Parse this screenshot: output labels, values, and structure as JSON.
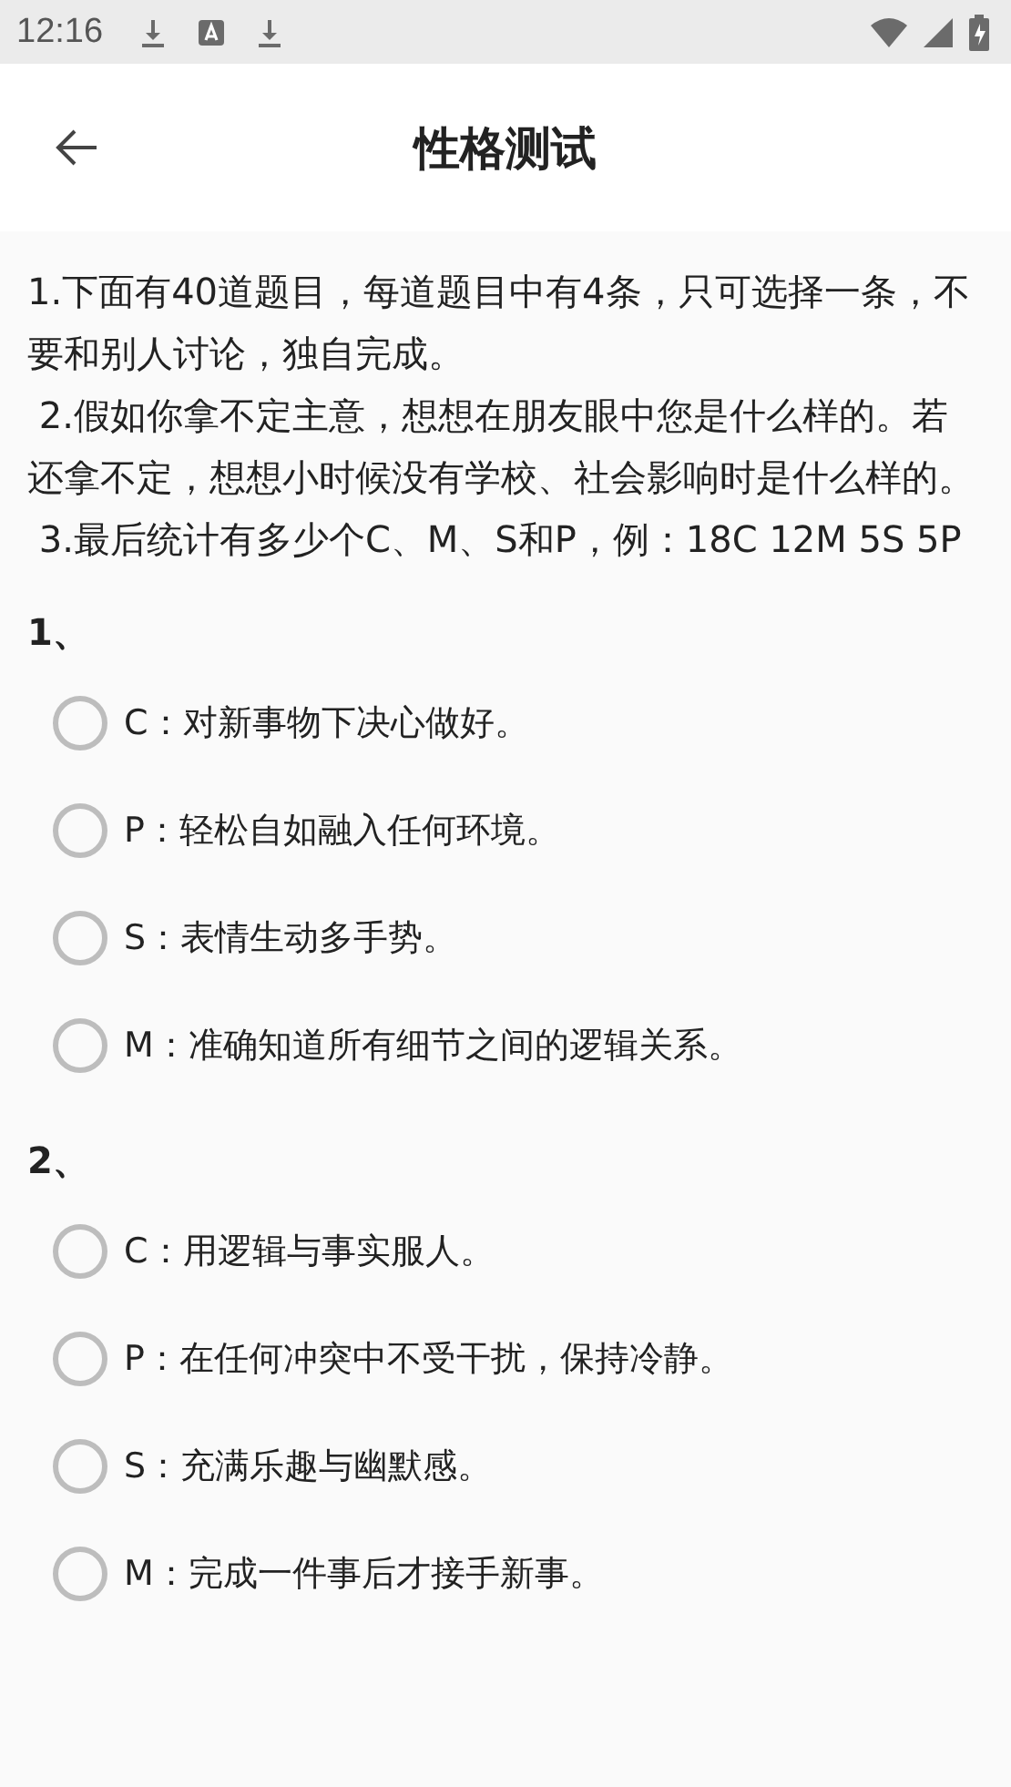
{
  "status_bar": {
    "time": "12:16"
  },
  "header": {
    "title": "性格测试"
  },
  "instructions": [
    "1.下面有40道题目，每道题目中有4条，只可选择一条，不要和别人讨论，独自完成。",
    " 2.假如你拿不定主意，想想在朋友眼中您是什么样的。若还拿不定，想想小时候没有学校、社会影响时是什么样的。",
    " 3.最后统计有多少个C、M、S和P，例：18C 12M 5S 5P"
  ],
  "questions": [
    {
      "number": "1、",
      "options": [
        {
          "label": "C：对新事物下决心做好。",
          "selected": false
        },
        {
          "label": "P：轻松自如融入任何环境。",
          "selected": false
        },
        {
          "label": "S：表情生动多手势。",
          "selected": false
        },
        {
          "label": "M：准确知道所有细节之间的逻辑关系。",
          "selected": false
        }
      ]
    },
    {
      "number": "2、",
      "options": [
        {
          "label": "C：用逻辑与事实服人。",
          "selected": false
        },
        {
          "label": "P：在任何冲突中不受干扰，保持冷静。",
          "selected": false
        },
        {
          "label": "S：充满乐趣与幽默感。",
          "selected": false
        },
        {
          "label": "M：完成一件事后才接手新事。",
          "selected": false
        }
      ]
    }
  ]
}
